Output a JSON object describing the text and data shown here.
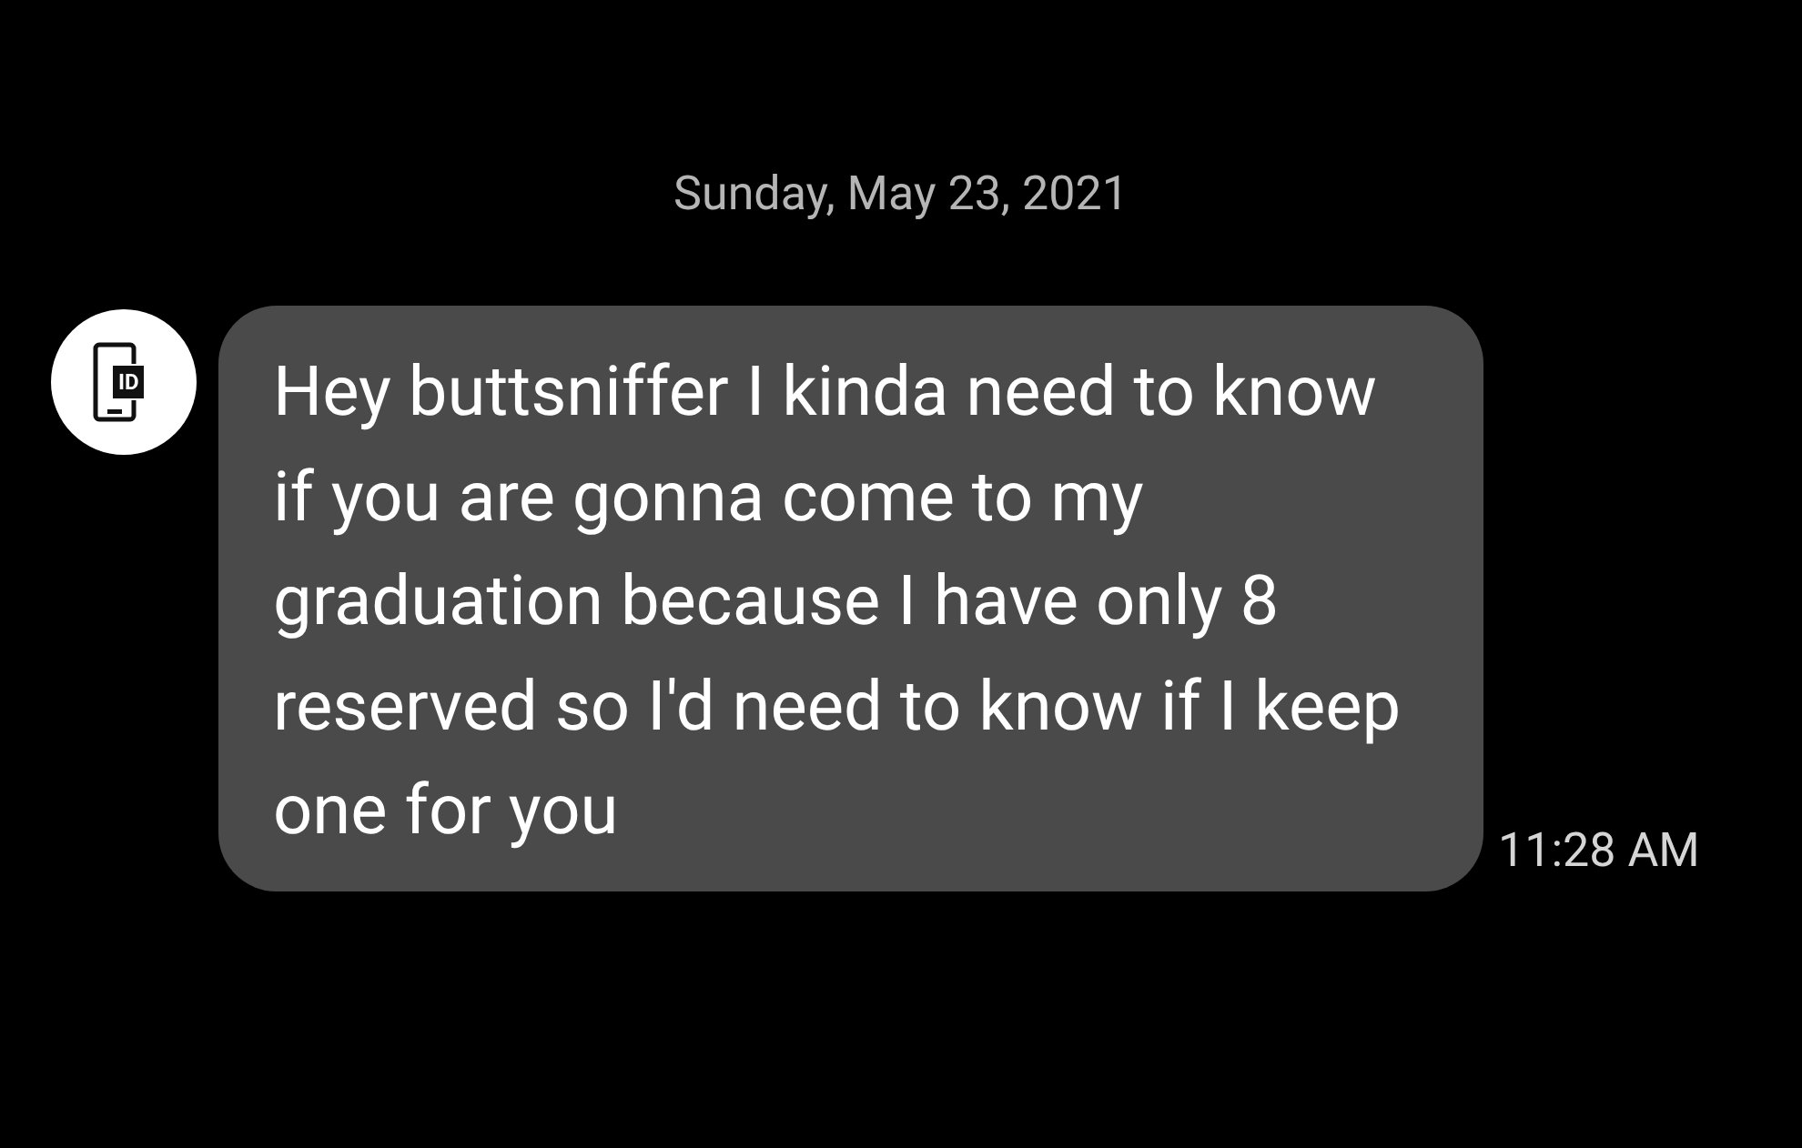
{
  "date_header": "Sunday, May 23, 2021",
  "message": {
    "avatar_badge": "ID",
    "text": "Hey buttsniffer I kinda need to know if you are gonna come to my graduation because I have only 8 reserved so I'd need to know if I keep one for you",
    "time": "11:28 AM"
  }
}
